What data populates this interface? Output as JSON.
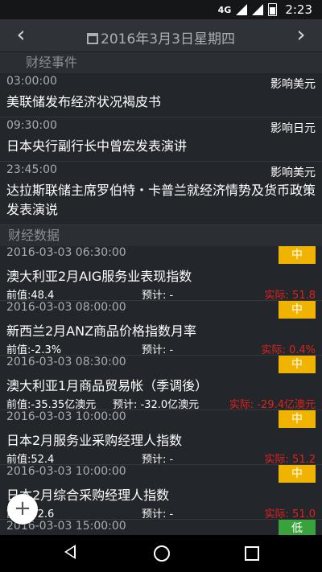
{
  "status_bar": {
    "network": "4G",
    "time": "2:23"
  },
  "header": {
    "date": "2016年3月3日星期四",
    "prev_icon": "chevron-left-icon",
    "next_icon": "chevron-right-icon"
  },
  "events_section": {
    "label": "财经事件"
  },
  "events": [
    {
      "time": "03:00:00",
      "impact": "影响美元",
      "title": "美联储发布经济状况褐皮书"
    },
    {
      "time": "09:30:00",
      "impact": "影响日元",
      "title": "日本央行副行长中曾宏发表演讲"
    },
    {
      "time": "23:45:00",
      "impact": "影响美元",
      "title": "达拉斯联储主席罗伯特・卡普兰就经济情势及货币政策发表演说"
    }
  ],
  "data_section": {
    "label": "财经数据"
  },
  "data_items": [
    {
      "datetime": "2016-03-03 06:30:00",
      "importance": "中",
      "name": "澳大利亚2月AIG服务业表现指数",
      "previous": "前值:48.4",
      "forecast": "预计: -",
      "actual": "实际: 51.8"
    },
    {
      "datetime": "2016-03-03 08:00:00",
      "importance": "中",
      "name": "新西兰2月ANZ商品价格指数月率",
      "previous": "前值:-2.3%",
      "forecast": "预计: -",
      "actual": "实际: 0.4%"
    },
    {
      "datetime": "2016-03-03 08:30:00",
      "importance": "中",
      "name": "澳大利亚1月商品贸易帐（季调後）",
      "previous": "前值:-35.35亿澳元",
      "forecast": "预计: -32.0亿澳元",
      "actual": "实际: -29.4亿澳元"
    },
    {
      "datetime": "2016-03-03 10:00:00",
      "importance": "中",
      "name": "日本2月服务业采购经理人指数",
      "previous": "前值:52.4",
      "forecast": "预计: -",
      "actual": "实际: 51.2"
    },
    {
      "datetime": "2016-03-03 10:00:00",
      "importance": "中",
      "name": "日本2月综合采购经理人指数",
      "previous": "前值:52.6",
      "forecast": "预计: -",
      "actual": "实际: 51.0"
    },
    {
      "datetime": "2016-03-03 15:00:00",
      "importance": "低",
      "name": "",
      "previous": "",
      "forecast": "",
      "actual": ""
    }
  ],
  "fab": {
    "label": "+"
  },
  "colors": {
    "background": "#23272b",
    "header": "#2f3337",
    "badge_mid": "#f0b400",
    "badge_low": "#3aa23a",
    "actual": "#e0221b"
  }
}
